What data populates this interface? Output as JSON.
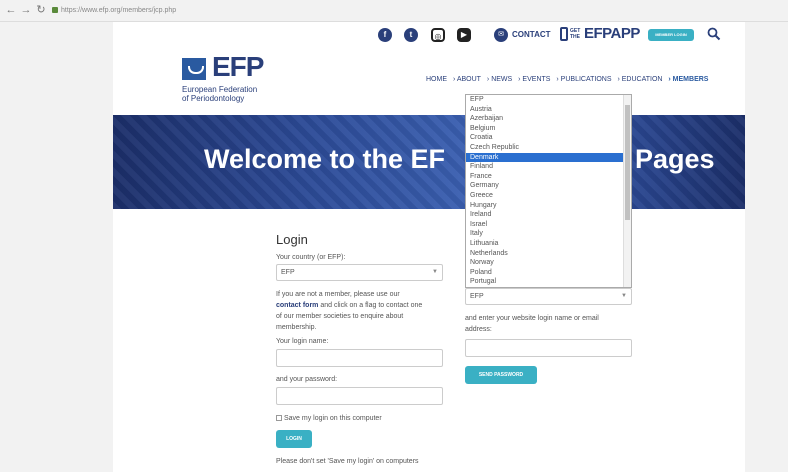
{
  "browser": {
    "url": "https://www.efp.org/members/jcp.php"
  },
  "topbar": {
    "facebook_icon": "facebook-icon",
    "twitter_icon": "twitter-icon",
    "instagram_icon": "instagram-icon",
    "youtube_icon": "youtube-icon",
    "contact_label": "CONTACT",
    "get_small": "GET THE",
    "get_app_label": "EFPAPP",
    "member_login_label": "MEMBER LOGIN"
  },
  "header": {
    "logo_text": "EFP",
    "logo_sub_1": "European Federation",
    "logo_sub_2": "of Periodontology",
    "nav": [
      "HOME",
      "› ABOUT",
      "› NEWS",
      "› EVENTS",
      "› PUBLICATIONS",
      "› EDUCATION",
      "› MEMBERS"
    ]
  },
  "banner": {
    "title_left": "Welcome to the EF",
    "title_right": "Pages"
  },
  "login": {
    "heading": "Login",
    "country_label": "Your country (or EFP):",
    "country_value": "EFP",
    "info_1": "If you are not a member, please use our",
    "info_link": "contact form",
    "info_2": " and click on a flag to contact one",
    "info_3": "of our member societies to enquire about",
    "info_4": "membership.",
    "login_name_label": "Your login name:",
    "password_label": "and your password:",
    "save_label": "Save my login on this computer",
    "login_button": "LOGIN",
    "note": "Please don't set 'Save my login' on computers"
  },
  "forgot": {
    "country_value": "EFP",
    "instruction_1": "and enter your website login name or email",
    "instruction_2": "address:",
    "send_button": "SEND PASSWORD"
  },
  "dropdown": {
    "options": [
      "EFP",
      "Austria",
      "Azerbaijan",
      "Belgium",
      "Croatia",
      "Czech Republic",
      "Denmark",
      "Finland",
      "France",
      "Germany",
      "Greece",
      "Hungary",
      "Ireland",
      "Israel",
      "Italy",
      "Lithuania",
      "Netherlands",
      "Norway",
      "Poland",
      "Portugal"
    ],
    "highlighted": "Denmark",
    "highlight_color": "#2a6fd0"
  },
  "colors": {
    "brand": "#2a3f7a",
    "accent": "#3ab0c4"
  }
}
